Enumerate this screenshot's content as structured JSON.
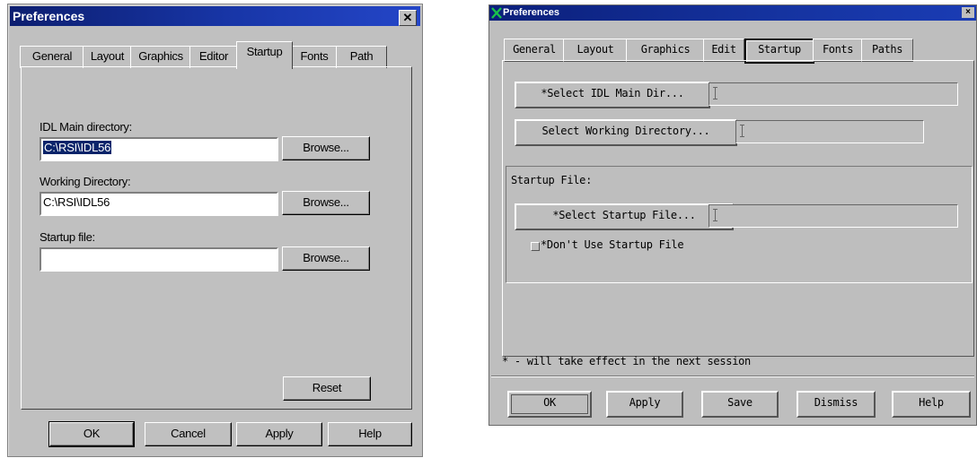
{
  "win_dialog": {
    "title": "Preferences",
    "close_glyph": "✕",
    "tabs": [
      {
        "label": "General"
      },
      {
        "label": "Layout"
      },
      {
        "label": "Graphics"
      },
      {
        "label": "Editor"
      },
      {
        "label": "Startup"
      },
      {
        "label": "Fonts"
      },
      {
        "label": "Path"
      }
    ],
    "selected_tab": "Startup",
    "main_dir_label": "IDL Main directory:",
    "main_dir_value": "C:\\RSI\\IDL56",
    "working_dir_label": "Working Directory:",
    "working_dir_value": "C:\\RSI\\IDL56",
    "startup_file_label": "Startup file:",
    "startup_file_value": "",
    "browse_label": "Browse...",
    "reset_label": "Reset",
    "ok_label": "OK",
    "cancel_label": "Cancel",
    "apply_label": "Apply",
    "help_label": "Help"
  },
  "motif_dialog": {
    "title": "Preferences",
    "close_glyph": "×",
    "tabs": [
      {
        "label": "General"
      },
      {
        "label": "Layout"
      },
      {
        "label": "Graphics"
      },
      {
        "label": "Edit"
      },
      {
        "label": "Startup"
      },
      {
        "label": "Fonts"
      },
      {
        "label": "Paths"
      }
    ],
    "selected_tab": "Startup",
    "select_main_dir_label": "*Select IDL Main Dir...",
    "select_working_dir_label": "Select Working Directory...",
    "startup_file_group_label": "Startup File:",
    "select_startup_file_label": "*Select Startup File...",
    "dont_use_startup_label": "*Don't Use Startup File",
    "dont_use_startup_checked": false,
    "footnote": "* - will take effect in the next session",
    "ok_label": "OK",
    "apply_label": "Apply",
    "save_label": "Save",
    "dismiss_label": "Dismiss",
    "help_label": "Help"
  }
}
